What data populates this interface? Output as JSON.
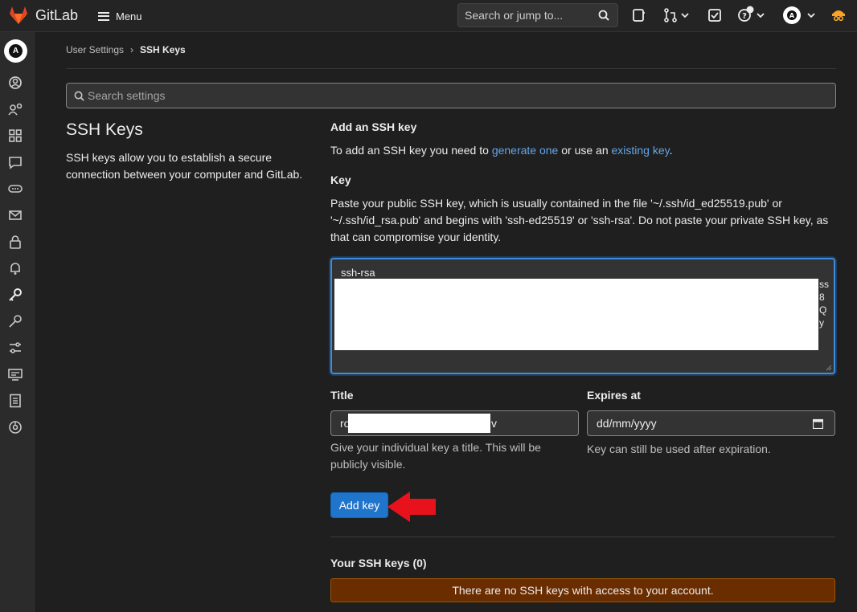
{
  "topbar": {
    "brand": "GitLab",
    "menu_label": "Menu",
    "search_placeholder": "Search or jump to..."
  },
  "breadcrumb": {
    "parent": "User Settings",
    "separator": "›",
    "current": "SSH Keys"
  },
  "settings_search": {
    "placeholder": "Search settings"
  },
  "section": {
    "title": "SSH Keys",
    "description": "SSH keys allow you to establish a secure connection between your computer and GitLab."
  },
  "add_key": {
    "heading": "Add an SSH key",
    "intro_prefix": "To add an SSH key you need to ",
    "generate_link": "generate one",
    "intro_middle": " or use an ",
    "existing_link": "existing key",
    "intro_suffix": ".",
    "key_label": "Key",
    "key_help": "Paste your public SSH key, which is usually contained in the file '~/.ssh/id_ed25519.pub' or '~/.ssh/id_rsa.pub' and begins with 'ssh-ed25519' or 'ssh-rsa'. Do not paste your private SSH key, as that can compromise your identity.",
    "key_value_first_line": "ssh-rsa",
    "title_label": "Title",
    "title_value_visible_start": "ro",
    "title_value_visible_end": "v",
    "title_hint": "Give your individual key a title. This will be publicly visible.",
    "expires_label": "Expires at",
    "expires_placeholder": "dd/mm/yyyy",
    "expires_hint": "Key can still be used after expiration.",
    "submit_label": "Add key"
  },
  "your_keys": {
    "heading": "Your SSH keys (0)",
    "empty_message": "There are no SSH keys with access to your account."
  },
  "colors": {
    "accent": "#1f75cb",
    "link": "#63a6e9",
    "alert_bg": "#6a2d00",
    "arrow": "#e8121c"
  }
}
